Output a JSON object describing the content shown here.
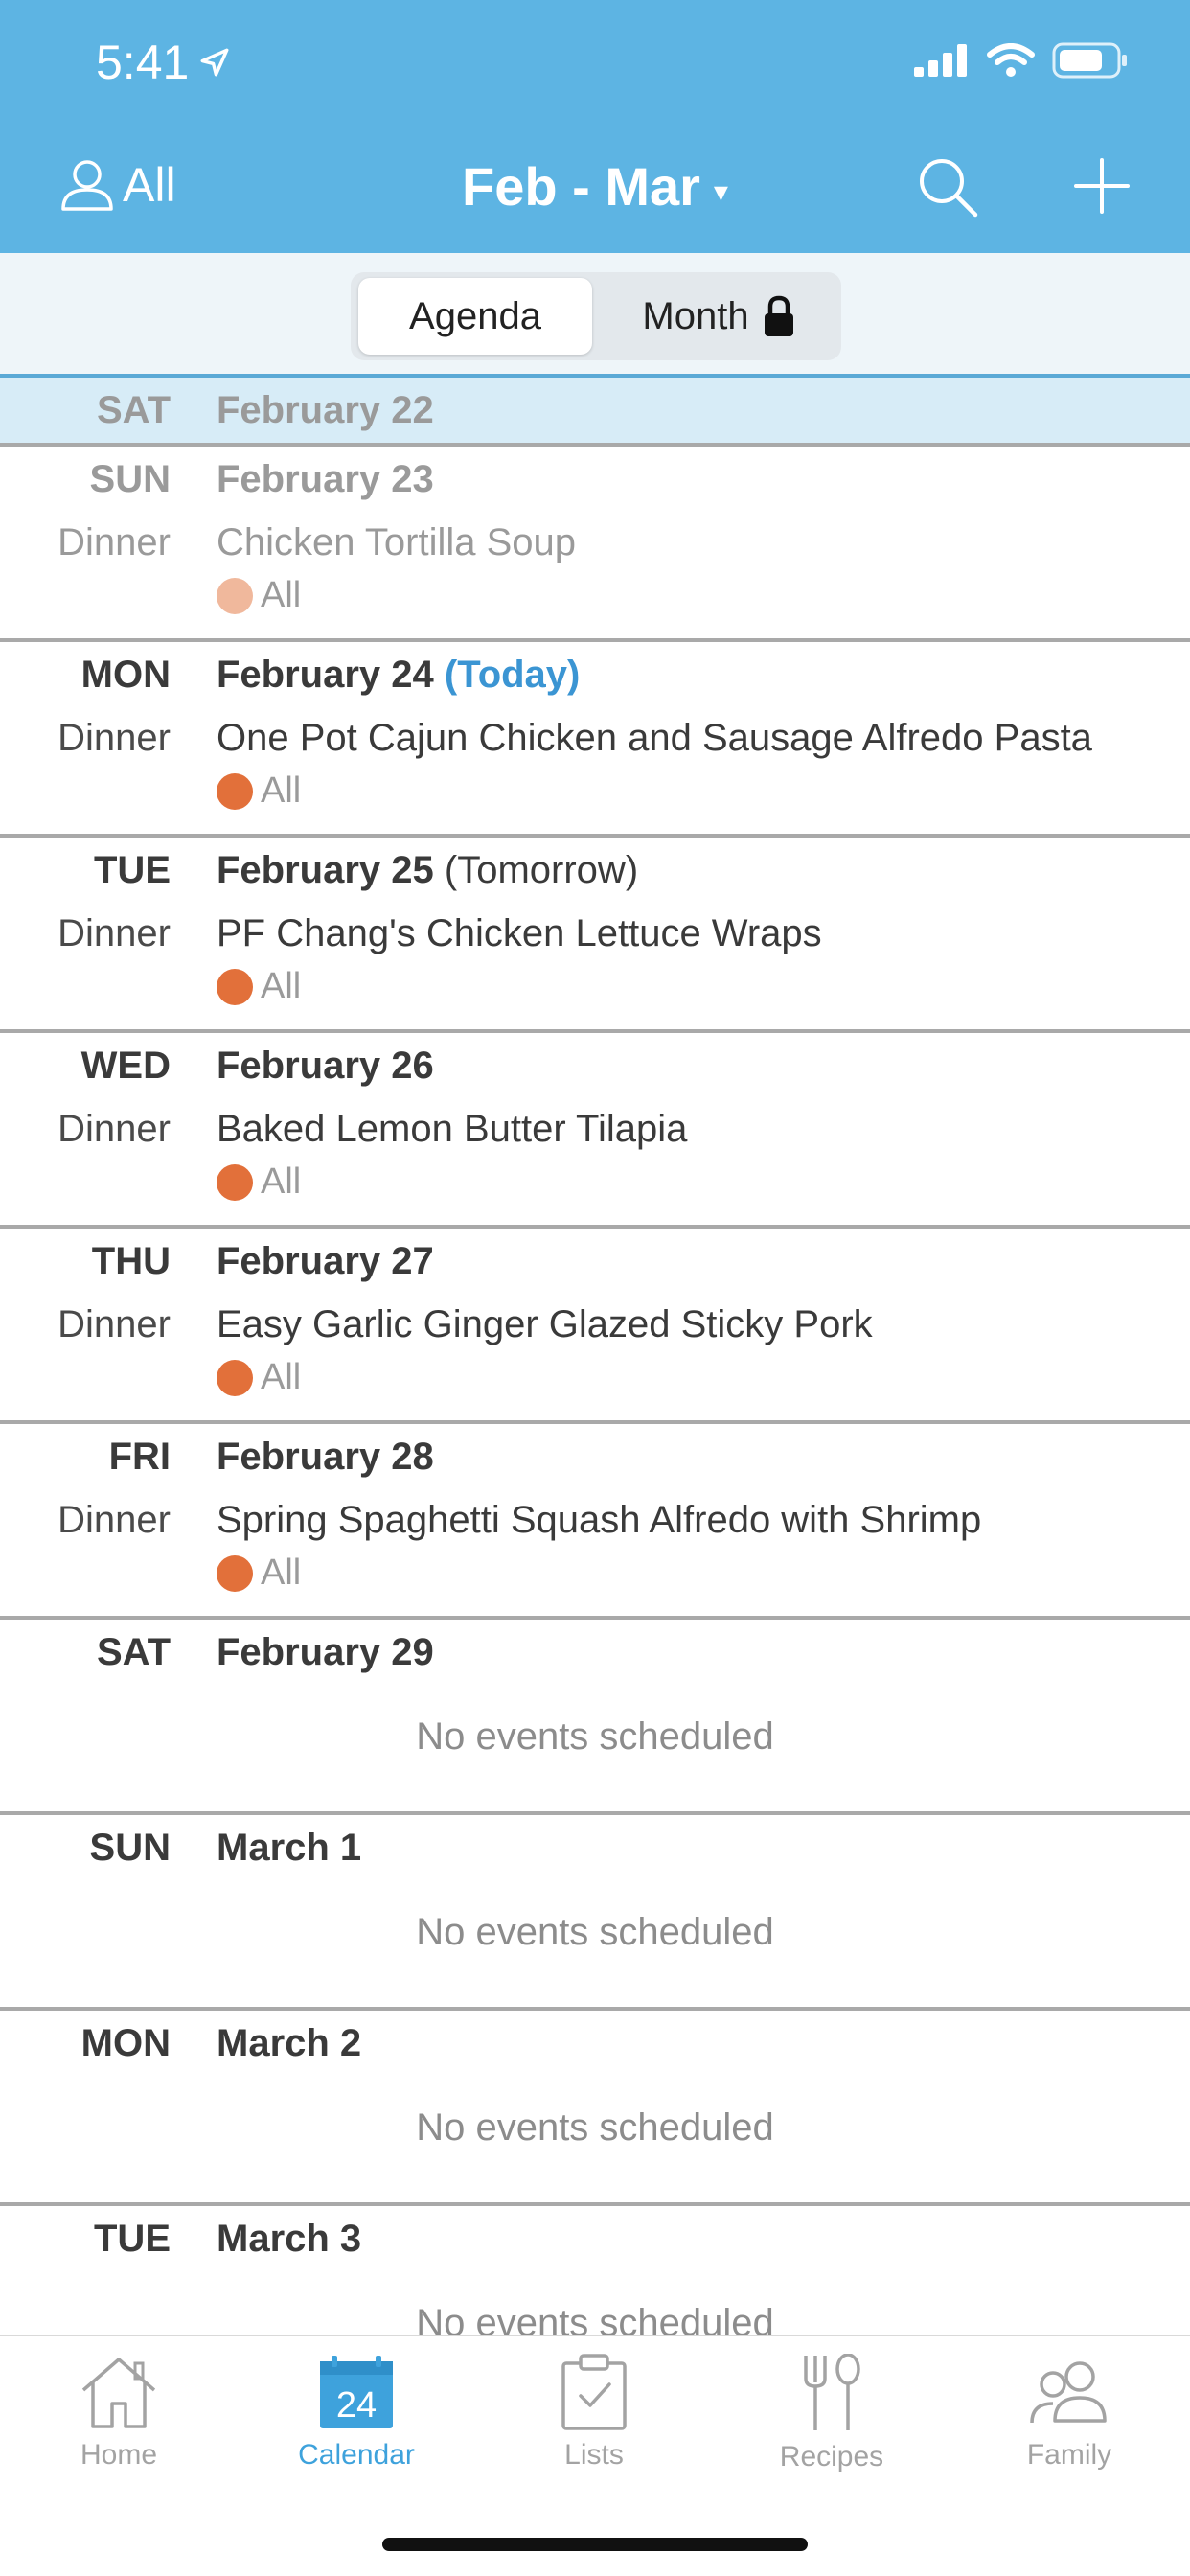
{
  "status": {
    "time": "5:41"
  },
  "nav": {
    "filter_label": "All",
    "title": "Feb - Mar",
    "caret": "▾"
  },
  "segmented": {
    "agenda": "Agenda",
    "month": "Month"
  },
  "days": [
    {
      "dow": "SAT",
      "date": "February 22",
      "suffix": ""
    },
    {
      "dow": "SUN",
      "date": "February 23",
      "suffix": "",
      "meal": "Dinner",
      "recipe": "Chicken Tortilla Soup",
      "who": "All"
    },
    {
      "dow": "MON",
      "date": "February 24",
      "suffix": "(Today)",
      "meal": "Dinner",
      "recipe": "One Pot Cajun Chicken and Sausage Alfredo Pasta",
      "who": "All"
    },
    {
      "dow": "TUE",
      "date": "February 25",
      "suffix": "(Tomorrow)",
      "meal": "Dinner",
      "recipe": "PF Chang's Chicken Lettuce Wraps",
      "who": "All"
    },
    {
      "dow": "WED",
      "date": "February 26",
      "suffix": "",
      "meal": "Dinner",
      "recipe": "Baked Lemon Butter Tilapia",
      "who": "All"
    },
    {
      "dow": "THU",
      "date": "February 27",
      "suffix": "",
      "meal": "Dinner",
      "recipe": "Easy Garlic Ginger Glazed Sticky Pork",
      "who": "All"
    },
    {
      "dow": "FRI",
      "date": "February 28",
      "suffix": "",
      "meal": "Dinner",
      "recipe": "Spring Spaghetti Squash Alfredo with Shrimp",
      "who": "All"
    },
    {
      "dow": "SAT",
      "date": "February 29",
      "empty": "No events scheduled"
    },
    {
      "dow": "SUN",
      "date": "March 1",
      "empty": "No events scheduled"
    },
    {
      "dow": "MON",
      "date": "March 2",
      "empty": "No events scheduled"
    },
    {
      "dow": "TUE",
      "date": "March 3",
      "empty": "No events scheduled"
    }
  ],
  "tabs": [
    {
      "label": "Home",
      "icon": "home-icon"
    },
    {
      "label": "Calendar",
      "icon": "calendar-icon",
      "badge": "24"
    },
    {
      "label": "Lists",
      "icon": "clipboard-icon"
    },
    {
      "label": "Recipes",
      "icon": "fork-spoon-icon"
    },
    {
      "label": "Family",
      "icon": "people-icon"
    }
  ],
  "colors": {
    "header": "#5db4e3",
    "accent": "#3b95d3",
    "dot": "#e2703a"
  }
}
